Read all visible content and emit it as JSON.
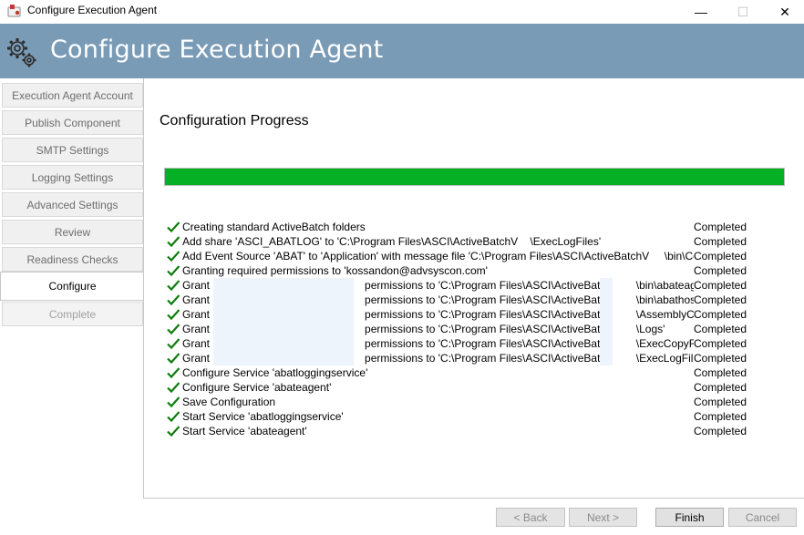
{
  "window": {
    "title": "Configure Execution Agent",
    "minimize_glyph": "—",
    "maximize_glyph": "☐",
    "close_glyph": "✕"
  },
  "banner": {
    "title": "Configure Execution Agent",
    "icon": "gears-icon"
  },
  "sidebar": {
    "items": [
      {
        "label": "Execution Agent Account",
        "state": "visited"
      },
      {
        "label": "Publish Component",
        "state": "visited"
      },
      {
        "label": "SMTP Settings",
        "state": "visited"
      },
      {
        "label": "Logging Settings",
        "state": "visited"
      },
      {
        "label": "Advanced Settings",
        "state": "visited"
      },
      {
        "label": "Review",
        "state": "visited"
      },
      {
        "label": "Readiness Checks",
        "state": "visited"
      },
      {
        "label": "Configure",
        "state": "active"
      },
      {
        "label": "Complete",
        "state": "disabled"
      }
    ]
  },
  "main": {
    "section_title": "Configuration Progress",
    "progress": 1.0,
    "progress_color": "#06b025",
    "log": [
      {
        "text": "Creating standard ActiveBatch folders",
        "status": "Completed"
      },
      {
        "text": "Add share 'ASCI_ABATLOG' to 'C:\\Program Files\\ASCI\\ActiveBatchV    \\ExecLogFiles'",
        "status": "Completed"
      },
      {
        "text": "Add Event Source 'ABAT' to 'Application' with message file 'C:\\Program Files\\ASCI\\ActiveBatchV     \\bin\\Cor",
        "status": "Completed"
      },
      {
        "text": "Granting required permissions to 'kossandon@advsyscon.com'",
        "status": "Completed"
      },
      {
        "text": "Grant                                                   permissions to 'C:\\Program Files\\ASCI\\ActiveBatch        \\bin\\abateagent",
        "status": "Completed"
      },
      {
        "text": "Grant                                                   permissions to 'C:\\Program Files\\ASCI\\ActiveBatch        \\bin\\abathost.ex",
        "status": "Completed"
      },
      {
        "text": "Grant                                                   permissions to 'C:\\Program Files\\ASCI\\ActiveBatch        \\AssemblyCache",
        "status": "Completed"
      },
      {
        "text": "Grant                                                   permissions to 'C:\\Program Files\\ASCI\\ActiveBatch        \\Logs'",
        "status": "Completed"
      },
      {
        "text": "Grant                                                   permissions to 'C:\\Program Files\\ASCI\\ActiveBatch        \\ExecCopyFiles'",
        "status": "Completed"
      },
      {
        "text": "Grant                                                   permissions to 'C:\\Program Files\\ASCI\\ActiveBatch        \\ExecLogFiles'",
        "status": "Completed"
      },
      {
        "text": "Configure Service 'abatloggingservice'",
        "status": "Completed"
      },
      {
        "text": "Configure Service 'abateagent'",
        "status": "Completed"
      },
      {
        "text": "Save Configuration",
        "status": "Completed"
      },
      {
        "text": "Start Service 'abatloggingservice'",
        "status": "Completed"
      },
      {
        "text": "Start Service 'abateagent'",
        "status": "Completed"
      }
    ],
    "check_color": "#107c10"
  },
  "footer": {
    "back_label": "< Back",
    "next_label": "Next >",
    "finish_label": "Finish",
    "cancel_label": "Cancel"
  }
}
